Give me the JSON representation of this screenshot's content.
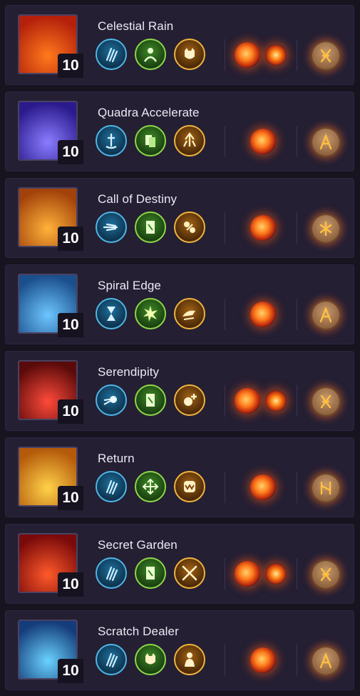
{
  "skills": [
    {
      "name": "Celestial Rain",
      "level": "10",
      "art": [
        "#ff7a1c",
        "#b4200b"
      ],
      "tripods": [
        [
          "blue",
          "claw-icon"
        ],
        [
          "green",
          "spirit-icon"
        ],
        [
          "gold",
          "beast-icon"
        ]
      ],
      "gems": 2,
      "rune": "rune-x-icon"
    },
    {
      "name": "Quadra Accelerate",
      "level": "10",
      "art": [
        "#8a7cff",
        "#2a1a8c"
      ],
      "tripods": [
        [
          "blue",
          "sword-stand-icon"
        ],
        [
          "green",
          "cards-icon"
        ],
        [
          "gold",
          "upward-burst-icon"
        ]
      ],
      "gems": 1,
      "rune": "rune-a-icon"
    },
    {
      "name": "Call of Destiny",
      "level": "10",
      "art": [
        "#ffb23a",
        "#a2420a"
      ],
      "tripods": [
        [
          "blue",
          "dash-icon"
        ],
        [
          "green",
          "card-swap-icon"
        ],
        [
          "gold",
          "orbs-icon"
        ]
      ],
      "gems": 1,
      "rune": "rune-star-icon"
    },
    {
      "name": "Spiral Edge",
      "level": "10",
      "art": [
        "#6ec6ff",
        "#1a4f8c"
      ],
      "tripods": [
        [
          "blue",
          "hourglass-icon"
        ],
        [
          "green",
          "burst-icon"
        ],
        [
          "gold",
          "charge-icon"
        ]
      ],
      "gems": 1,
      "rune": "rune-a-icon"
    },
    {
      "name": "Serendipity",
      "level": "10",
      "art": [
        "#ff4a3a",
        "#5a0a0a"
      ],
      "tripods": [
        [
          "blue",
          "comet-icon"
        ],
        [
          "green",
          "card-swap-icon"
        ],
        [
          "gold",
          "orb-plus-icon"
        ]
      ],
      "gems": 2,
      "rune": "rune-x-icon"
    },
    {
      "name": "Return",
      "level": "10",
      "art": [
        "#ffd24a",
        "#b45a0a"
      ],
      "tripods": [
        [
          "blue",
          "claw-icon"
        ],
        [
          "green",
          "arrows-icon"
        ],
        [
          "gold",
          "maw-icon"
        ]
      ],
      "gems": 1,
      "rune": "rune-h-icon"
    },
    {
      "name": "Secret Garden",
      "level": "10",
      "art": [
        "#ff5a2a",
        "#7a0a0a"
      ],
      "tripods": [
        [
          "blue",
          "claw-icon"
        ],
        [
          "green",
          "card-swap-icon"
        ],
        [
          "gold",
          "crossed-swords-icon"
        ]
      ],
      "gems": 2,
      "rune": "rune-x-icon"
    },
    {
      "name": "Scratch Dealer",
      "level": "10",
      "art": [
        "#6ad2ff",
        "#143c7a"
      ],
      "tripods": [
        [
          "blue",
          "claw-icon"
        ],
        [
          "green",
          "beast-icon"
        ],
        [
          "gold",
          "person-icon"
        ]
      ],
      "gems": 1,
      "rune": "rune-a-icon"
    }
  ]
}
